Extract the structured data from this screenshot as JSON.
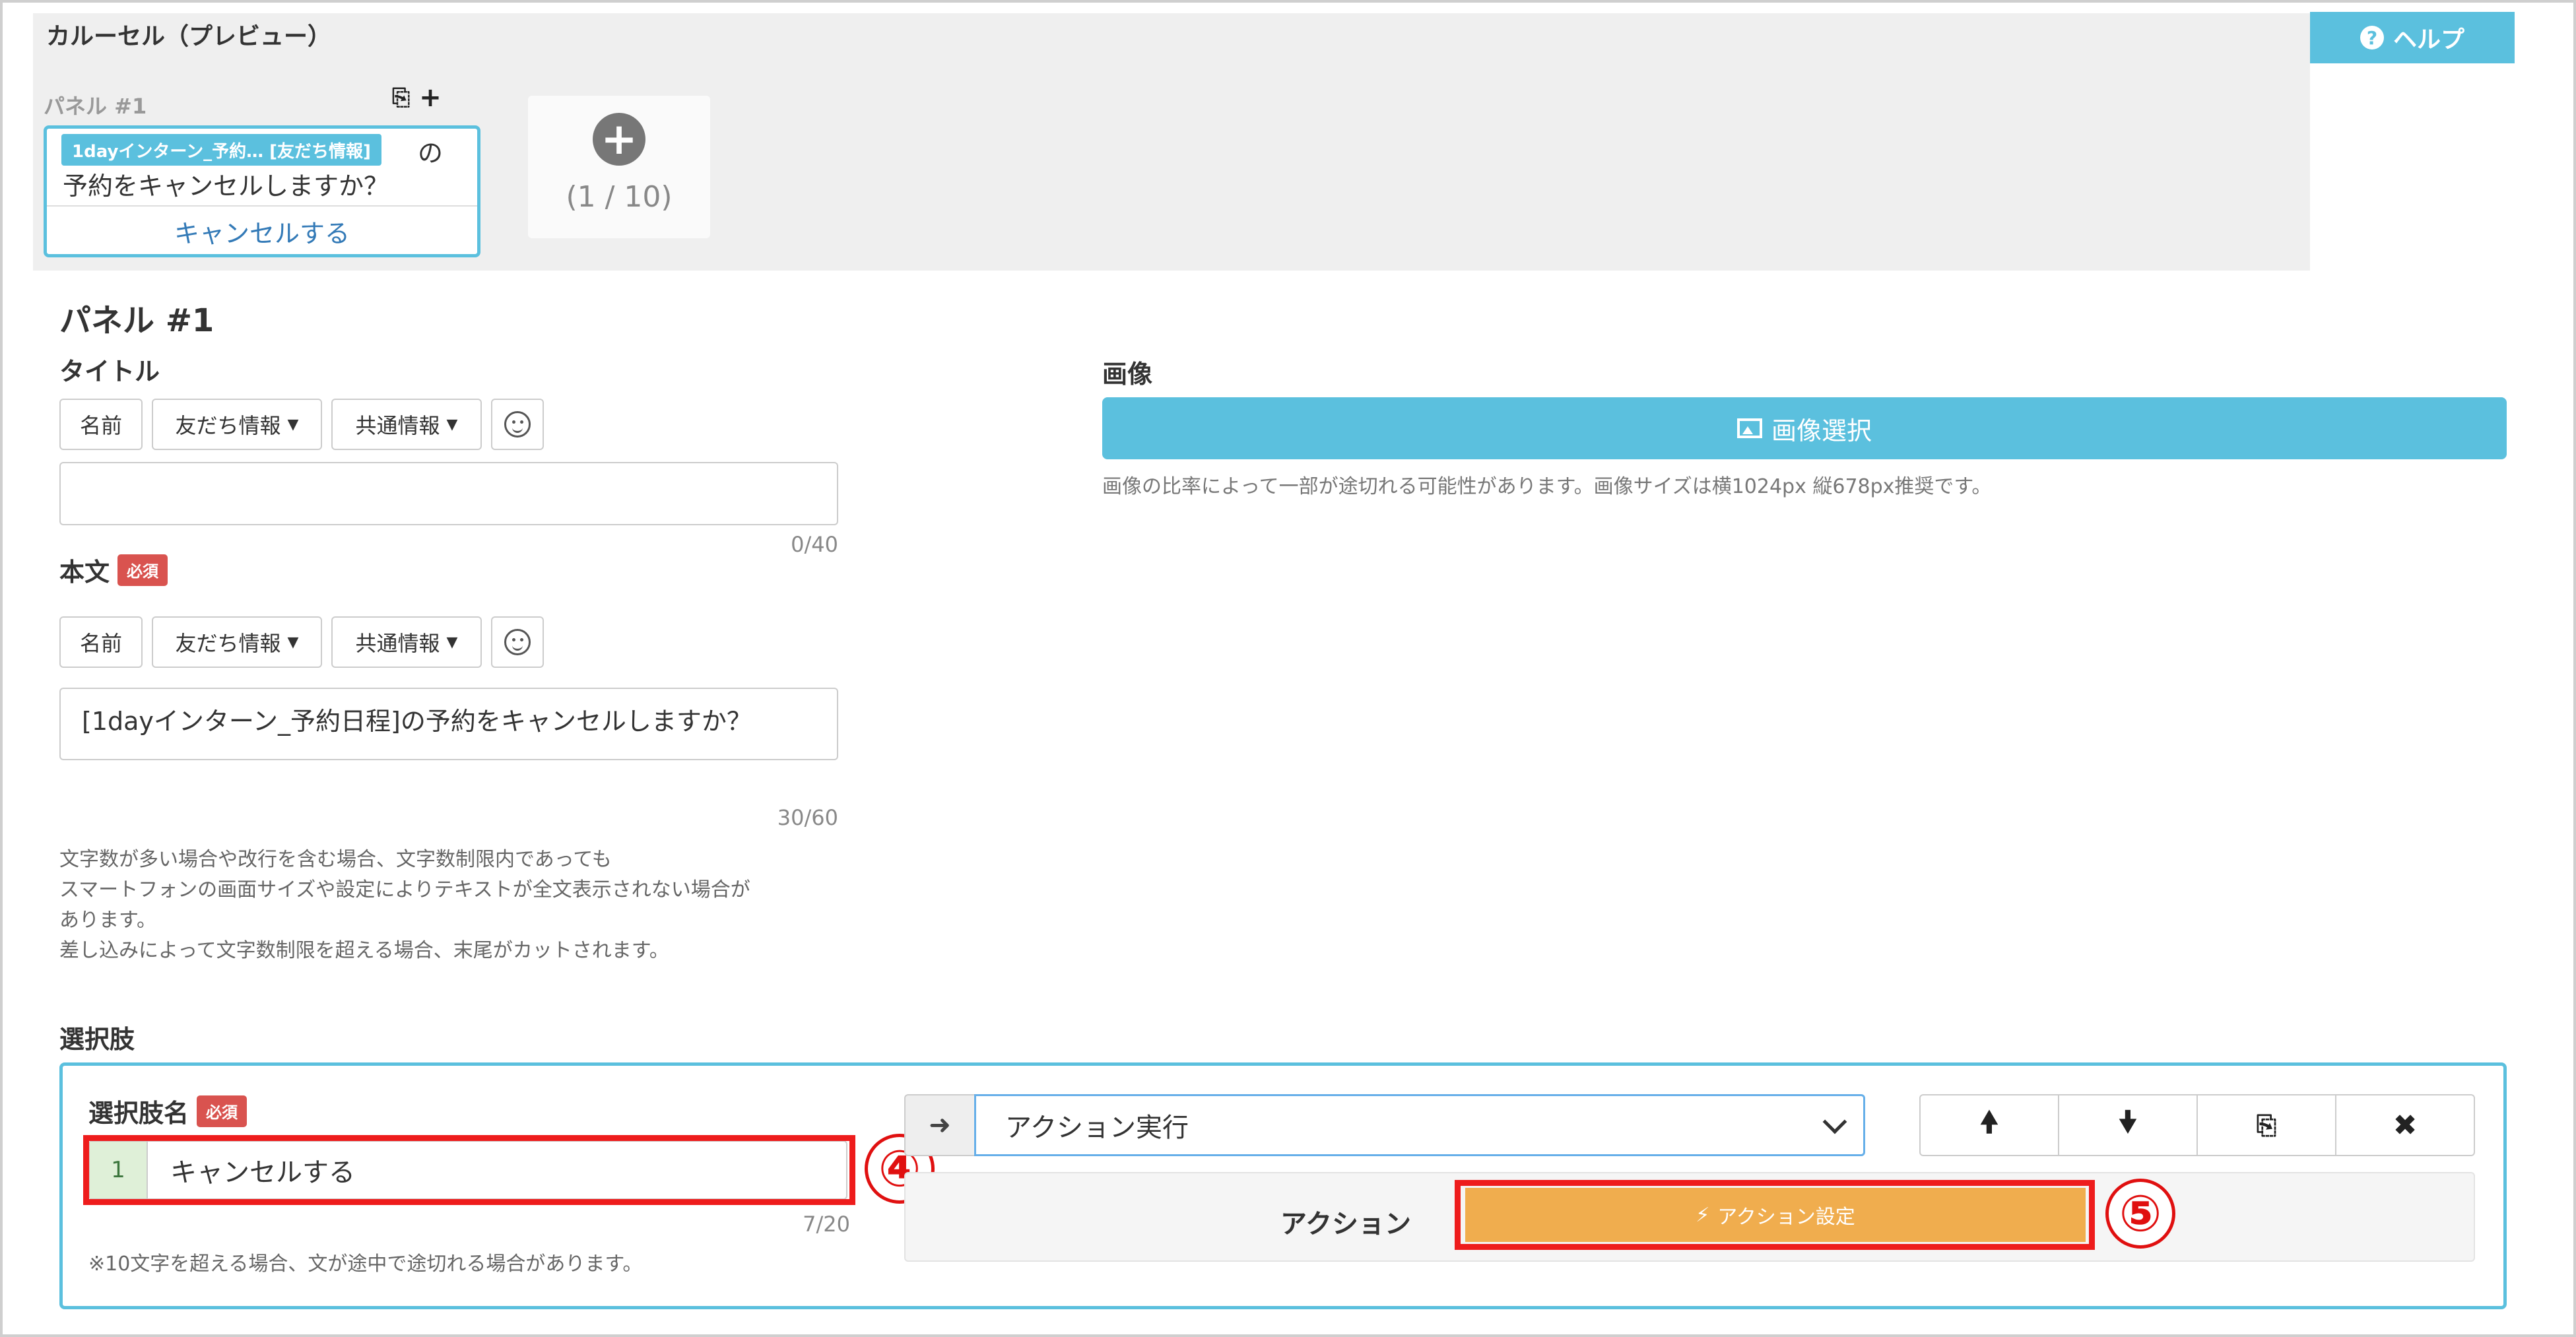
{
  "preview": {
    "title": "カルーセル（プレビュー）",
    "help_label": "ヘルプ",
    "panel_label": "パネル #1",
    "card": {
      "chip": "1dayインターン_予約… [友だち情報]",
      "tail": "の",
      "body": "予約をキャンセルしますか？",
      "link": "キャンセルする"
    },
    "add_count": "(1 / 10)"
  },
  "form": {
    "panel_heading": "パネル #1",
    "title_label": "タイトル",
    "toolbar": {
      "name": "名前",
      "friend_info": "友だち情報",
      "common_info": "共通情報"
    },
    "title_value": "",
    "title_counter": "0/40",
    "body_label": "本文",
    "required": "必須",
    "body_value": "[1dayインターン_予約日程]の予約をキャンセルしますか？",
    "body_counter": "30/60",
    "note_lines": [
      "文字数が多い場合や改行を含む場合、文字数制限内であっても",
      "スマートフォンの画面サイズや設定によりテキストが全文表示されない場合が",
      "あります。",
      "差し込みによって文字数制限を超える場合、末尾がカットされます。"
    ],
    "image_label": "画像",
    "image_button": "画像選択",
    "image_note": "画像の比率によって一部が途切れる可能性があります。画像サイズは横1024px 縦678px推奨です。"
  },
  "choices": {
    "label": "選択肢",
    "name_label": "選択肢名",
    "required": "必須",
    "row_number": "1",
    "name_value": "キャンセルする",
    "name_counter": "7/20",
    "name_note": "※10文字を超える場合、文が途中で途切れる場合があります。",
    "type_selected": "アクション実行",
    "action_label": "アクション",
    "action_button": "アクション設定",
    "annotation_4": "④",
    "annotation_5": "⑤"
  },
  "colors": {
    "info": "#5bc0de",
    "danger": "#d9534f",
    "warning": "#f0ad4e",
    "highlight_red": "#ee1c1c"
  }
}
